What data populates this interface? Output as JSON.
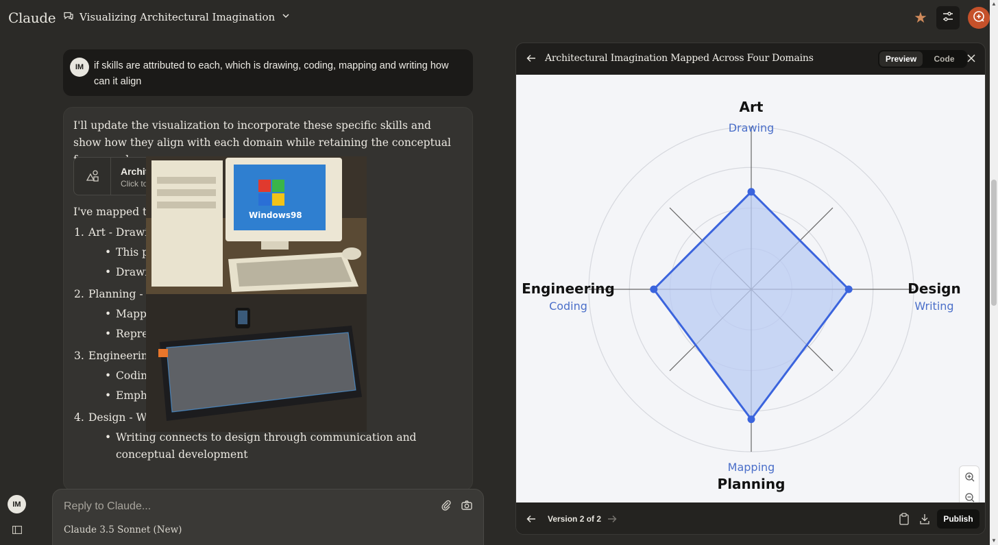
{
  "app": {
    "brand": "Claude"
  },
  "conversation": {
    "title": "Visualizing Architectural Imagination"
  },
  "user": {
    "initials": "IM"
  },
  "user_message": "if skills are attributed to each, which is drawing, coding, mapping and writing how can it align",
  "assistant": {
    "intro": "I'll update the visualization to incorporate these specific skills and show how they align with each domain while retaining the conceptual framework.",
    "artifact_chip": {
      "title": "Archit",
      "subtitle": "Click to"
    },
    "mapped_lead": "I've mapped the",
    "items": [
      {
        "num": "1.",
        "title": "Art - Drawi",
        "bullets": [
          "This pa                                                  spects of archite",
          "Drawi                                                   outlet"
        ]
      },
      {
        "num": "2.",
        "title": "Planning - ",
        "bullets": [
          "Mappi                                                   nization",
          "Repres                                                  n of space"
        ]
      },
      {
        "num": "3.",
        "title": "Engineerin",
        "bullets": [
          "Coding                                                  gineering",
          "Empha                                                  problem-solving"
        ]
      },
      {
        "num": "4.",
        "title": "Design - Writing",
        "bullets": [
          "Writing connects to design through communication and conceptual development"
        ]
      }
    ]
  },
  "composer": {
    "placeholder": "Reply to Claude...",
    "model": "Claude 3.5 Sonnet (New)"
  },
  "panel": {
    "title": "Architectural Imagination Mapped Across Four Domains",
    "tabs": [
      "Preview",
      "Code"
    ],
    "active_tab": "Preview",
    "version": "Version 2 of 2",
    "publish": "Publish"
  },
  "colors": {
    "accent": "#d08a5b",
    "radar_stroke": "#3b64dd",
    "radar_fill": "#b9cbf3",
    "skill_label": "#4b6fc9"
  },
  "icons": [
    "chat-bubble-icon",
    "chevron-down-icon",
    "star-icon",
    "sliders-icon",
    "new-chat-icon",
    "shapes-icon",
    "paperclip-icon",
    "camera-icon",
    "sidebar-toggle-icon",
    "arrow-left-icon",
    "close-icon",
    "zoom-in-icon",
    "zoom-out-icon",
    "expand-icon",
    "arrow-right-icon",
    "clipboard-icon",
    "download-icon"
  ],
  "chart_data": {
    "type": "radar",
    "title": "",
    "axes": [
      {
        "domain": "Art",
        "skill": "Drawing",
        "value": 0.6
      },
      {
        "domain": "Design",
        "skill": "Writing",
        "value": 0.6
      },
      {
        "domain": "Planning",
        "skill": "Mapping",
        "value": 0.8
      },
      {
        "domain": "Engineering",
        "skill": "Coding",
        "value": 0.6
      }
    ],
    "rings": 4,
    "diagonal_axes": true,
    "grid": true,
    "legend": "none"
  }
}
